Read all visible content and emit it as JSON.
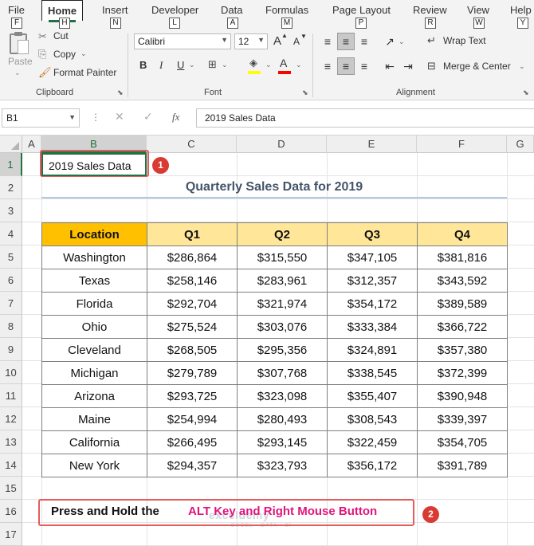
{
  "tabs": [
    {
      "label": "File",
      "key": "F"
    },
    {
      "label": "Home",
      "key": "H",
      "active": true
    },
    {
      "label": "Insert",
      "key": "N"
    },
    {
      "label": "Developer",
      "key": "L"
    },
    {
      "label": "Data",
      "key": "A"
    },
    {
      "label": "Formulas",
      "key": "M"
    },
    {
      "label": "Page Layout",
      "key": "P"
    },
    {
      "label": "Review",
      "key": "R"
    },
    {
      "label": "View",
      "key": "W"
    },
    {
      "label": "Help",
      "key": "Y"
    }
  ],
  "ribbon": {
    "clipboard": {
      "paste": "Paste",
      "cut": "Cut",
      "copy": "Copy",
      "format_painter": "Format Painter",
      "label": "Clipboard"
    },
    "font": {
      "name": "Calibri",
      "size": "12",
      "bold": "B",
      "italic": "I",
      "underline": "U",
      "grow": "A",
      "shrink": "A",
      "label": "Font",
      "fill_color": "#ffff00",
      "font_color": "#ff0000"
    },
    "alignment": {
      "wrap_text": "Wrap Text",
      "merge_center": "Merge & Center",
      "label": "Alignment"
    }
  },
  "formula_bar": {
    "name_box": "B1",
    "content": "2019 Sales Data",
    "fx": "fx"
  },
  "columns": [
    "A",
    "B",
    "C",
    "D",
    "E",
    "F",
    "G"
  ],
  "rows": [
    "1",
    "2",
    "3",
    "4",
    "5",
    "6",
    "7",
    "8",
    "9",
    "10",
    "11",
    "12",
    "13",
    "14",
    "15",
    "16",
    "17"
  ],
  "sheet": {
    "b1": "2019 Sales Data",
    "title": "Quarterly Sales Data for 2019",
    "headers": [
      "Location",
      "Q1",
      "Q2",
      "Q3",
      "Q4"
    ],
    "table": [
      [
        "Washington",
        "$286,864",
        "$315,550",
        "$347,105",
        "$381,816"
      ],
      [
        "Texas",
        "$258,146",
        "$283,961",
        "$312,357",
        "$343,592"
      ],
      [
        "Florida",
        "$292,704",
        "$321,974",
        "$354,172",
        "$389,589"
      ],
      [
        "Ohio",
        "$275,524",
        "$303,076",
        "$333,384",
        "$366,722"
      ],
      [
        "Cleveland",
        "$268,505",
        "$295,356",
        "$324,891",
        "$357,380"
      ],
      [
        "Michigan",
        "$279,789",
        "$307,768",
        "$338,545",
        "$372,399"
      ],
      [
        "Arizona",
        "$293,725",
        "$323,098",
        "$355,407",
        "$390,948"
      ],
      [
        "Maine",
        "$254,994",
        "$280,493",
        "$308,543",
        "$339,397"
      ],
      [
        "California",
        "$266,495",
        "$293,145",
        "$322,459",
        "$354,705"
      ],
      [
        "New York",
        "$294,357",
        "$323,793",
        "$356,172",
        "$391,789"
      ]
    ]
  },
  "callouts": {
    "badge1": "1",
    "badge2": "2",
    "instruction_prefix": "Press and Hold the",
    "instruction_highlight": "ALT Key and Right Mouse Button"
  },
  "watermark": {
    "name": "exceldemy",
    "tagline": "EXCEL · DATA · BI"
  }
}
